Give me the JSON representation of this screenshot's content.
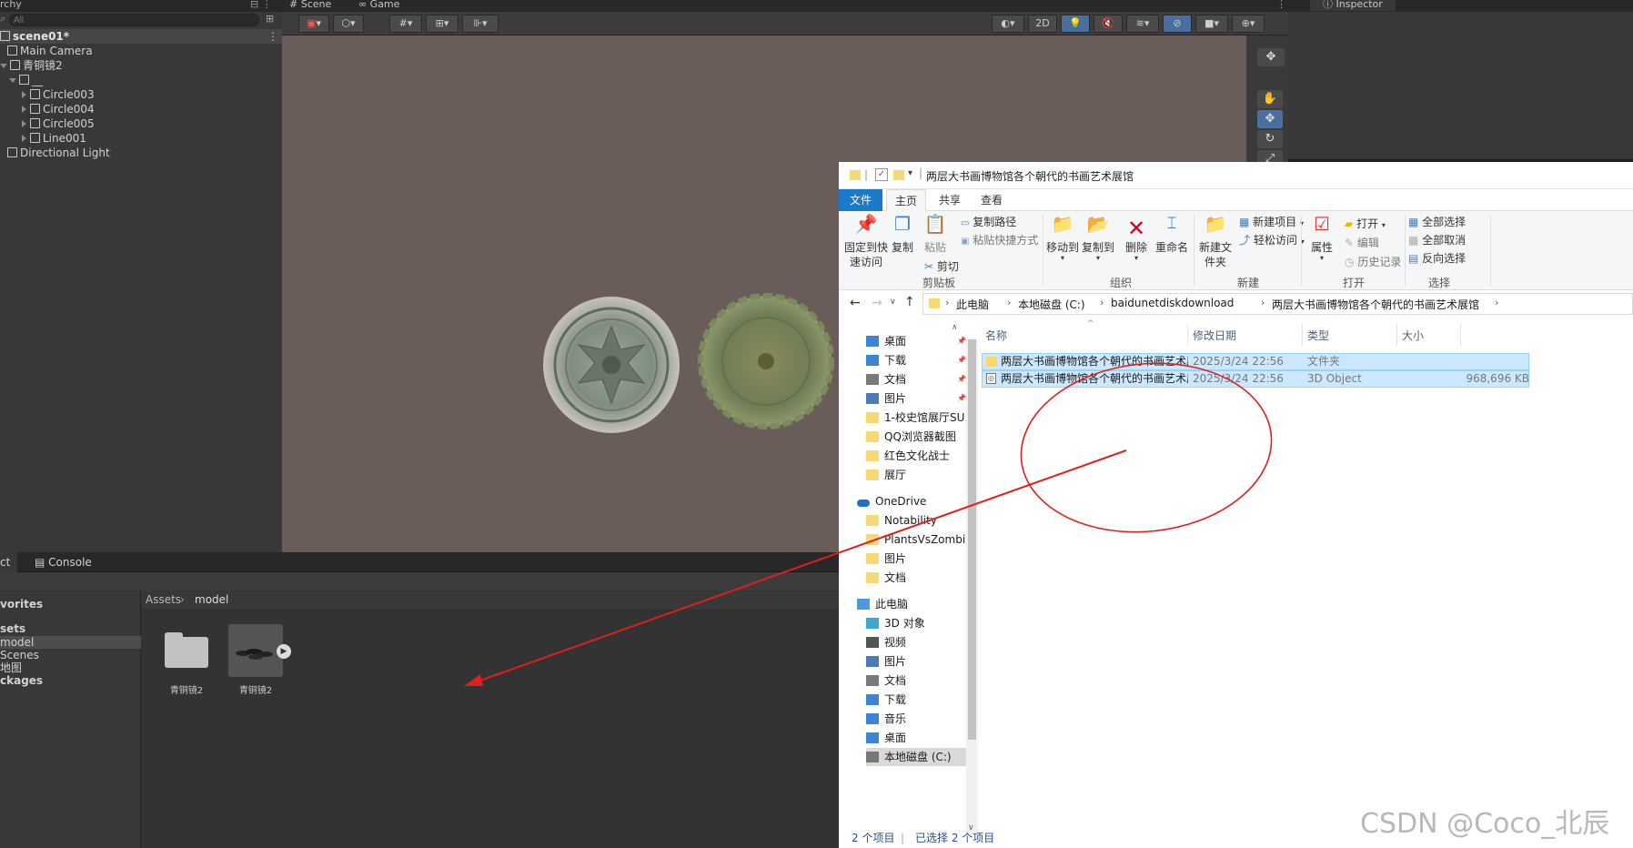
{
  "hierarchy": {
    "tab_label": "rchy",
    "search_placeholder": "All",
    "scene": "scene01*",
    "items": [
      {
        "label": "Main Camera",
        "depth": 0
      },
      {
        "label": "青铜镜2",
        "depth": 0
      },
      {
        "label": "__",
        "depth": 1
      },
      {
        "label": "Circle003",
        "depth": 2
      },
      {
        "label": "Circle004",
        "depth": 2
      },
      {
        "label": "Circle005",
        "depth": 2
      },
      {
        "label": "Line001",
        "depth": 2
      },
      {
        "label": "Directional Light",
        "depth": 0
      }
    ]
  },
  "scene_view": {
    "tabs": [
      "Scene",
      "Game"
    ],
    "mode_2d": "2D"
  },
  "inspector": {
    "tab_label": "Inspector"
  },
  "project": {
    "tabs": [
      "ct",
      "Console"
    ],
    "favorites": [
      "vorites",
      "sets",
      "model",
      "Scenes",
      "地图",
      "ckages"
    ],
    "breadcrumb": [
      "Assets",
      "model"
    ],
    "assets": [
      {
        "name": "青铜镜2",
        "kind": "folder"
      },
      {
        "name": "青铜镜2",
        "kind": "model"
      }
    ]
  },
  "explorer": {
    "title": "两层大书画博物馆各个朝代的书画艺术展馆",
    "ribbon_tabs": [
      "文件",
      "主页",
      "共享",
      "查看"
    ],
    "clipboard": {
      "pin": "固定到快速访问",
      "copy": "复制",
      "paste": "粘贴",
      "copy_path": "复制路径",
      "paste_shortcut": "粘贴快捷方式",
      "cut": "剪切",
      "group": "剪贴板"
    },
    "organize": {
      "move_to": "移动到",
      "copy_to": "复制到",
      "delete": "删除",
      "rename": "重命名",
      "group": "组织"
    },
    "new": {
      "new_folder": "新建文件夹",
      "new_item": "新建项目",
      "easy_access": "轻松访问",
      "group": "新建"
    },
    "open": {
      "properties": "属性",
      "open": "打开",
      "edit": "编辑",
      "history": "历史记录",
      "group": "打开"
    },
    "select": {
      "select_all": "全部选择",
      "select_none": "全部取消",
      "invert": "反向选择",
      "group": "选择"
    },
    "address": [
      "此电脑",
      "本地磁盘 (C:)",
      "baidunetdiskdownload",
      "两层大书画博物馆各个朝代的书画艺术展馆"
    ],
    "nav_items": [
      {
        "label": "桌面",
        "kind": "desk"
      },
      {
        "label": "下载",
        "kind": "down"
      },
      {
        "label": "文档",
        "kind": "doc"
      },
      {
        "label": "图片",
        "kind": "pic"
      },
      {
        "label": "1-校史馆展厅SU",
        "kind": "folder"
      },
      {
        "label": "QQ浏览器截图",
        "kind": "folder"
      },
      {
        "label": "红色文化战士",
        "kind": "folder"
      },
      {
        "label": "展厅",
        "kind": "folder"
      },
      {
        "label": "OneDrive",
        "kind": "cloud"
      },
      {
        "label": "Notability",
        "kind": "folder"
      },
      {
        "label": "PlantsVsZombi",
        "kind": "folder"
      },
      {
        "label": "图片",
        "kind": "folder"
      },
      {
        "label": "文档",
        "kind": "folder"
      },
      {
        "label": "此电脑",
        "kind": "pc"
      },
      {
        "label": "3D 对象",
        "kind": "3d"
      },
      {
        "label": "视频",
        "kind": "video"
      },
      {
        "label": "图片",
        "kind": "pic"
      },
      {
        "label": "文档",
        "kind": "doc"
      },
      {
        "label": "下载",
        "kind": "down"
      },
      {
        "label": "音乐",
        "kind": "music"
      },
      {
        "label": "桌面",
        "kind": "desk"
      },
      {
        "label": "本地磁盘 (C:)",
        "kind": "disk"
      }
    ],
    "columns": [
      "名称",
      "修改日期",
      "类型",
      "大小"
    ],
    "files": [
      {
        "name": "两层大书画博物馆各个朝代的书画艺术展...",
        "date": "2025/3/24 22:56",
        "type": "文件夹",
        "size": ""
      },
      {
        "name": "两层大书画博物馆各个朝代的书画艺术展...",
        "date": "2025/3/24 22:56",
        "type": "3D Object",
        "size": "968,696 KB"
      }
    ],
    "status_count": "2 个项目",
    "status_selected": "已选择 2 个项目"
  },
  "watermark": "CSDN @Coco_北辰",
  "colors": {
    "annotation": "#e01e1e",
    "selection": "#cce8ff",
    "unity_panel": "#383838"
  }
}
